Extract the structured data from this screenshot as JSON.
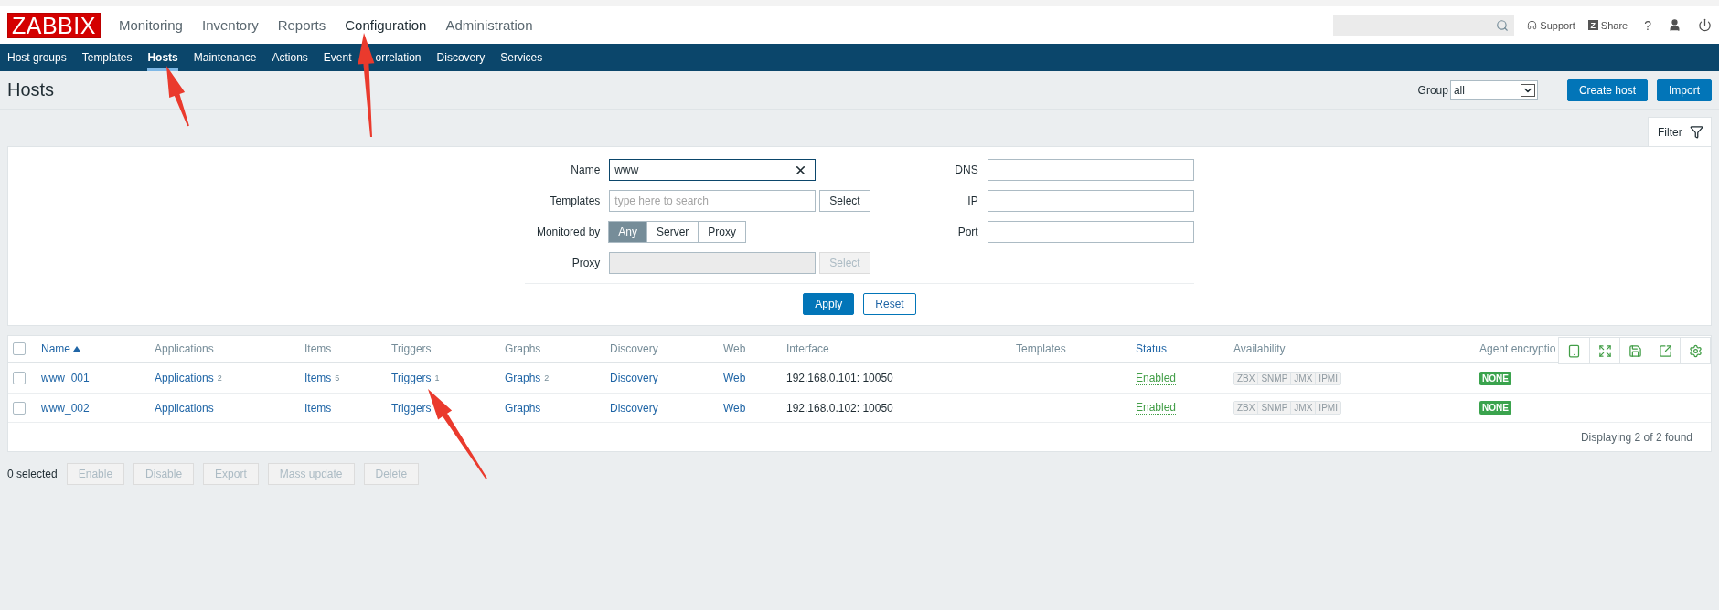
{
  "header": {
    "logo": "ZABBIX",
    "menu": [
      {
        "label": "Monitoring",
        "selected": false
      },
      {
        "label": "Inventory",
        "selected": false
      },
      {
        "label": "Reports",
        "selected": false
      },
      {
        "label": "Configuration",
        "selected": true
      },
      {
        "label": "Administration",
        "selected": false
      }
    ],
    "support": "Support",
    "share_badge": "Z",
    "share": "Share",
    "help": "?"
  },
  "nav": [
    {
      "label": "Host groups",
      "selected": false
    },
    {
      "label": "Templates",
      "selected": false
    },
    {
      "label": "Hosts",
      "selected": true
    },
    {
      "label": "Maintenance",
      "selected": false
    },
    {
      "label": "Actions",
      "selected": false
    },
    {
      "label": "Event",
      "label_rest": "orrelation",
      "selected": false
    },
    {
      "label": "Discovery",
      "selected": false
    },
    {
      "label": "Services",
      "selected": false
    }
  ],
  "page": {
    "title": "Hosts",
    "group_label": "Group",
    "group_value": "all",
    "buttons": [
      "Create host",
      "Import"
    ]
  },
  "filter": {
    "tab": "Filter",
    "left": [
      {
        "kind": "text",
        "label": "Name",
        "value": "www",
        "clearable": true,
        "disabled": false
      },
      {
        "kind": "picker",
        "label": "Templates",
        "placeholder": "type here to search",
        "button": "Select",
        "disabled": false
      },
      {
        "kind": "segmented",
        "label": "Monitored by",
        "options": [
          {
            "label": "Any",
            "selected": true
          },
          {
            "label": "Server",
            "selected": false
          },
          {
            "label": "Proxy",
            "selected": false
          }
        ]
      },
      {
        "kind": "picker",
        "label": "Proxy",
        "button": "Select",
        "disabled": true
      }
    ],
    "right": [
      {
        "kind": "text",
        "label": "DNS",
        "clearable": false,
        "disabled": false
      },
      {
        "kind": "text",
        "label": "IP",
        "clearable": false,
        "disabled": false
      },
      {
        "kind": "text",
        "label": "Port",
        "clearable": false,
        "disabled": false
      }
    ],
    "apply": "Apply",
    "reset": "Reset"
  },
  "table": {
    "all_checked": false,
    "columns": [
      {
        "label": "Name",
        "sortable": true,
        "sorted_ascending": true
      },
      {
        "label": "Applications",
        "sortable": false
      },
      {
        "label": "Items",
        "sortable": false
      },
      {
        "label": "Triggers",
        "sortable": false
      },
      {
        "label": "Graphs",
        "sortable": false
      },
      {
        "label": "Discovery",
        "sortable": false
      },
      {
        "label": "Web",
        "sortable": false
      },
      {
        "label": "Interface",
        "sortable": false
      },
      {
        "label": "Templates",
        "sortable": false
      },
      {
        "label": "Status",
        "sortable": true
      },
      {
        "label": "Availability",
        "sortable": false
      },
      {
        "label": "Agent encryptio",
        "sortable": false
      }
    ],
    "rows": [
      {
        "checked": false,
        "name": "www_001",
        "applications": {
          "label": "Applications",
          "count": "2"
        },
        "items": {
          "label": "Items",
          "count": "5"
        },
        "triggers": {
          "label": "Triggers",
          "count": "1"
        },
        "graphs": {
          "label": "Graphs",
          "count": "2"
        },
        "discovery": "Discovery",
        "web": "Web",
        "interface": "192.168.0.101: 10050",
        "status": {
          "label": "Enabled",
          "kind": "enabled"
        },
        "availability": [
          {
            "label": "ZBX",
            "available": false
          },
          {
            "label": "SNMP",
            "available": false
          },
          {
            "label": "JMX",
            "available": false
          },
          {
            "label": "IPMI",
            "available": false
          }
        ],
        "encryption": "NONE"
      },
      {
        "checked": false,
        "name": "www_002",
        "applications": {
          "label": "Applications"
        },
        "items": {
          "label": "Items"
        },
        "triggers": {
          "label": "Triggers"
        },
        "graphs": {
          "label": "Graphs"
        },
        "discovery": "Discovery",
        "web": "Web",
        "interface": "192.168.0.102: 10050",
        "status": {
          "label": "Enabled",
          "kind": "enabled"
        },
        "availability": [
          {
            "label": "ZBX",
            "available": false
          },
          {
            "label": "SNMP",
            "available": false
          },
          {
            "label": "JMX",
            "available": false
          },
          {
            "label": "IPMI",
            "available": false
          }
        ],
        "encryption": "NONE"
      }
    ],
    "footer": "Displaying 2 of 2 found"
  },
  "actions": {
    "selected_count": "0 selected",
    "buttons": [
      {
        "label": "Enable",
        "disabled": true
      },
      {
        "label": "Disable",
        "disabled": true
      },
      {
        "label": "Export",
        "disabled": true
      },
      {
        "label": "Mass update",
        "disabled": true
      },
      {
        "label": "Delete",
        "disabled": true
      }
    ]
  }
}
